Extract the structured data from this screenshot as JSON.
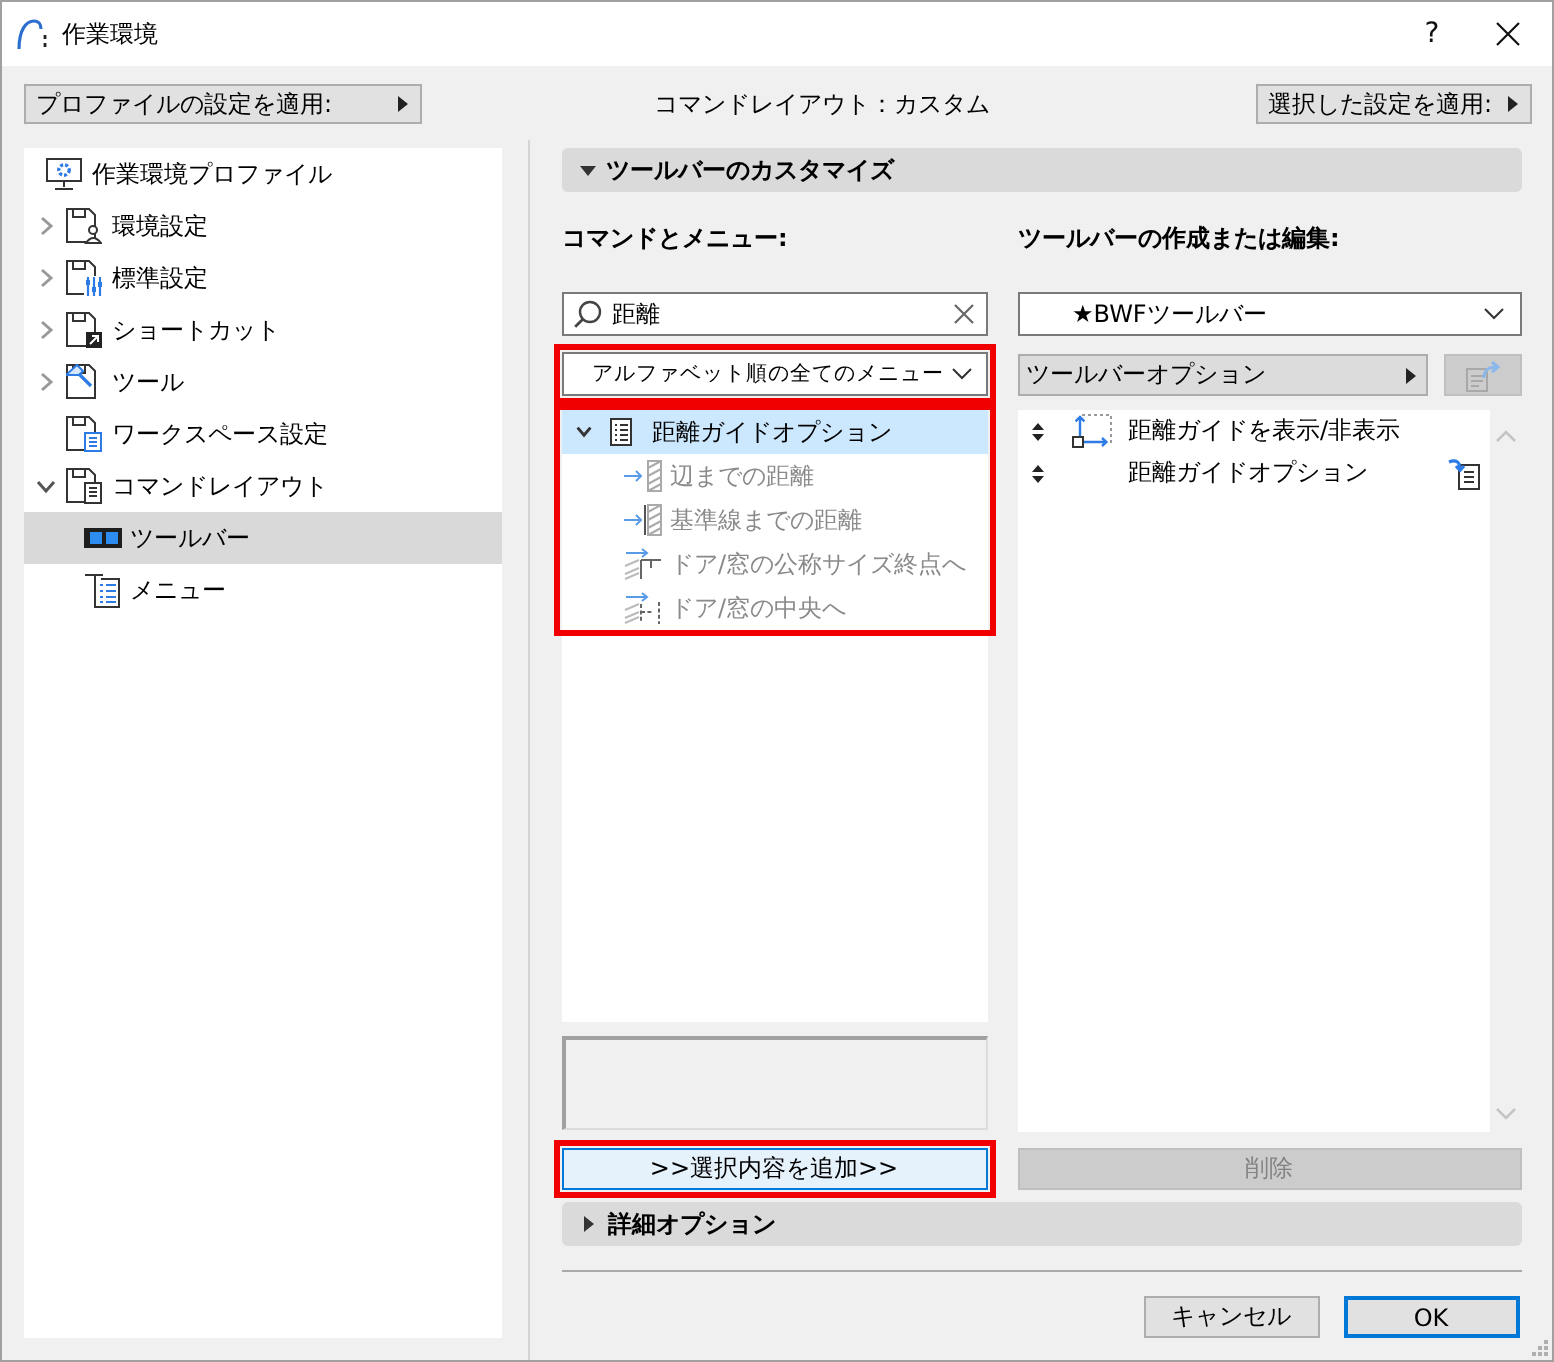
{
  "window": {
    "title": "作業環境",
    "help": "?"
  },
  "top_bar": {
    "apply_profile_button": "プロファイルの設定を適用:",
    "layout_status": "コマンドレイアウト：カスタム",
    "apply_selected_button": "選択した設定を適用:"
  },
  "sidebar": {
    "items": [
      {
        "kind": "root",
        "label": "作業環境プロファイル",
        "selected": false
      },
      {
        "kind": "group",
        "label": "環境設定",
        "expanded": false,
        "selected": false
      },
      {
        "kind": "group",
        "label": "標準設定",
        "expanded": false,
        "selected": false
      },
      {
        "kind": "group",
        "label": "ショートカット",
        "expanded": false,
        "selected": false
      },
      {
        "kind": "group",
        "label": "ツール",
        "expanded": false,
        "selected": false
      },
      {
        "kind": "item",
        "label": "ワークスペース設定",
        "selected": false
      },
      {
        "kind": "group",
        "label": "コマンドレイアウト",
        "expanded": true,
        "selected": false,
        "children": [
          {
            "label": "ツールバー",
            "selected": true
          },
          {
            "label": "メニュー",
            "selected": false
          }
        ]
      }
    ]
  },
  "customize_section": {
    "title": "ツールバーのカスタマイズ",
    "expanded": true
  },
  "commands": {
    "label": "コマンドとメニュー:",
    "search": {
      "value": "距離"
    },
    "filter_dropdown": {
      "value": "アルファベット順の全てのメニュー",
      "highlighted": true
    },
    "tree": {
      "highlighted": true,
      "items": [
        {
          "label": "距離ガイドオプション",
          "expanded": true,
          "selected": true,
          "children": [
            {
              "label": "辺までの距離",
              "selected": false,
              "disabled": true
            },
            {
              "label": "基準線までの距離",
              "selected": false,
              "disabled": true
            },
            {
              "label": "ドア/窓の公称サイズ終点へ",
              "selected": false,
              "disabled": true
            },
            {
              "label": "ドア/窓の中央へ",
              "selected": false,
              "disabled": true
            }
          ]
        }
      ]
    },
    "add_button": {
      "label": ">>選択内容を追加>>",
      "highlighted": true,
      "hovered": true
    }
  },
  "toolbar_editor": {
    "label": "ツールバーの作成または編集:",
    "toolbar_dropdown": {
      "value": "★BWFツールバー"
    },
    "options_button": "ツールバーオプション",
    "export_button": {
      "disabled": true
    },
    "items": [
      {
        "kind": "command",
        "label": "距離ガイドを表示/非表示",
        "selected": false
      },
      {
        "kind": "menu",
        "label": "距離ガイドオプション",
        "selected": false
      }
    ],
    "delete_button": {
      "label": "削除",
      "disabled": true
    }
  },
  "details_section": {
    "title": "詳細オプション",
    "expanded": false
  },
  "footer": {
    "buttons": [
      {
        "label": "キャンセル",
        "default": false
      },
      {
        "label": "OK",
        "default": true
      }
    ]
  }
}
